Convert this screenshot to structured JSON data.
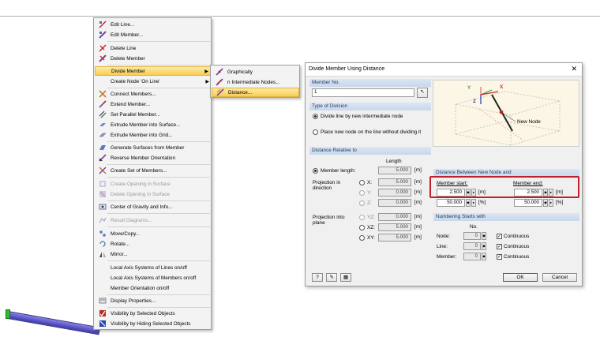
{
  "context_menu": {
    "items": [
      {
        "label": "Edit Line...",
        "icon": "pencil-line-icon",
        "disabled": false
      },
      {
        "label": "Edit Member...",
        "icon": "edit-member-icon",
        "disabled": false
      },
      {
        "label": "Delete Line",
        "icon": "delete-line-icon",
        "disabled": false
      },
      {
        "label": "Delete Member",
        "icon": "delete-member-icon",
        "disabled": false
      },
      {
        "label": "Divide Member",
        "icon": "",
        "disabled": false
      },
      {
        "label": "Create Node 'On Line'",
        "icon": "",
        "disabled": false
      },
      {
        "label": "Connect Members...",
        "icon": "connect-members-icon",
        "disabled": false
      },
      {
        "label": "Extend Member...",
        "icon": "extend-member-icon",
        "disabled": false
      },
      {
        "label": "Set Parallel Member...",
        "icon": "parallel-member-icon",
        "disabled": false
      },
      {
        "label": "Extrude Member into Surface...",
        "icon": "extrude-surface-icon",
        "disabled": false
      },
      {
        "label": "Extrude Member into Grid...",
        "icon": "extrude-grid-icon",
        "disabled": false
      },
      {
        "label": "Generate Surfaces from Member",
        "icon": "generate-surfaces-icon",
        "disabled": false
      },
      {
        "label": "Reverse Member Orientation",
        "icon": "reverse-orientation-icon",
        "disabled": false
      },
      {
        "label": "Create Set of Members...",
        "icon": "set-of-members-icon",
        "disabled": false
      },
      {
        "label": "Create Opening in Surface",
        "icon": "opening-icon",
        "disabled": true
      },
      {
        "label": "Delete Opening in Surface",
        "icon": "delete-opening-icon",
        "disabled": true
      },
      {
        "label": "Center of Gravity and Info...",
        "icon": "center-gravity-icon",
        "disabled": false
      },
      {
        "label": "Result Diagrams...",
        "icon": "result-diagrams-icon",
        "disabled": true
      },
      {
        "label": "Move/Copy...",
        "icon": "move-copy-icon",
        "disabled": false
      },
      {
        "label": "Rotate...",
        "icon": "rotate-icon",
        "disabled": false
      },
      {
        "label": "Mirror...",
        "icon": "mirror-icon",
        "disabled": false
      },
      {
        "label": "Local Axis Systems of Lines on/off",
        "icon": "",
        "disabled": false
      },
      {
        "label": "Local Axis Systems of Members on/off",
        "icon": "",
        "disabled": false
      },
      {
        "label": "Member Orientation on/off",
        "icon": "",
        "disabled": false
      },
      {
        "label": "Display Properties...",
        "icon": "display-properties-icon",
        "disabled": false
      },
      {
        "label": "Visibility by Selected Objects",
        "icon": "visibility-selected-icon",
        "disabled": false
      },
      {
        "label": "Visibility by Hiding Selected Objects",
        "icon": "visibility-hiding-icon",
        "disabled": false
      }
    ]
  },
  "submenu": {
    "items": [
      {
        "label": "Graphically",
        "icon": "graphically-icon"
      },
      {
        "label": "n Intermediate Nodes...",
        "icon": "intermediate-nodes-icon"
      },
      {
        "label": "Distance...",
        "icon": "distance-icon"
      }
    ]
  },
  "dialog": {
    "title": "Divide Member Using Distance",
    "close_glyph": "✕",
    "member_no": {
      "header": "Member No.",
      "value": "1"
    },
    "type_of_division": {
      "header": "Type of Division",
      "option1": "Divide line by new intermediate node",
      "option2": "Place new node on the line without dividing it"
    },
    "distance_relative": {
      "header": "Distance Relative to",
      "length_header": "Length",
      "member_length_label": "Member length:",
      "member_length_value": "5.000",
      "unit_m": "[m]",
      "projection_direction_label": "Projection in direction",
      "dir_x_label": "X:",
      "dir_x_value": "5.000",
      "dir_y_label": "Y:",
      "dir_y_value": "0.000",
      "dir_z_label": "Z:",
      "dir_z_value": "0.000",
      "projection_plane_label": "Projection into plane",
      "plane_yz_label": "YZ:",
      "plane_yz_value": "0.000",
      "plane_xz_label": "XZ:",
      "plane_xz_value": "5.000",
      "plane_xy_label": "XY:",
      "plane_xy_value": "5.000"
    },
    "preview": {
      "new_node_label": "New Node",
      "axis_x": "X",
      "axis_y": "Y",
      "axis_z": "Z"
    },
    "distance_between": {
      "header": "Distance Between New Node and",
      "member_start_label": "Member start:",
      "member_start_m": "2.500",
      "member_start_pct": "50.000",
      "member_end_label": "Member end:",
      "member_end_m": "2.500",
      "member_end_pct": "50.000",
      "unit_m": "[m]",
      "unit_pct": "[%]"
    },
    "numbering": {
      "header": "Numbering Starts with",
      "no_header": "No.",
      "node_label": "Node:",
      "node_value": "0",
      "line_label": "Line:",
      "line_value": "0",
      "member_label": "Member:",
      "member_value": "0",
      "continuous_label": "Continuous"
    },
    "buttons": {
      "ok": "OK",
      "cancel": "Cancel"
    }
  }
}
